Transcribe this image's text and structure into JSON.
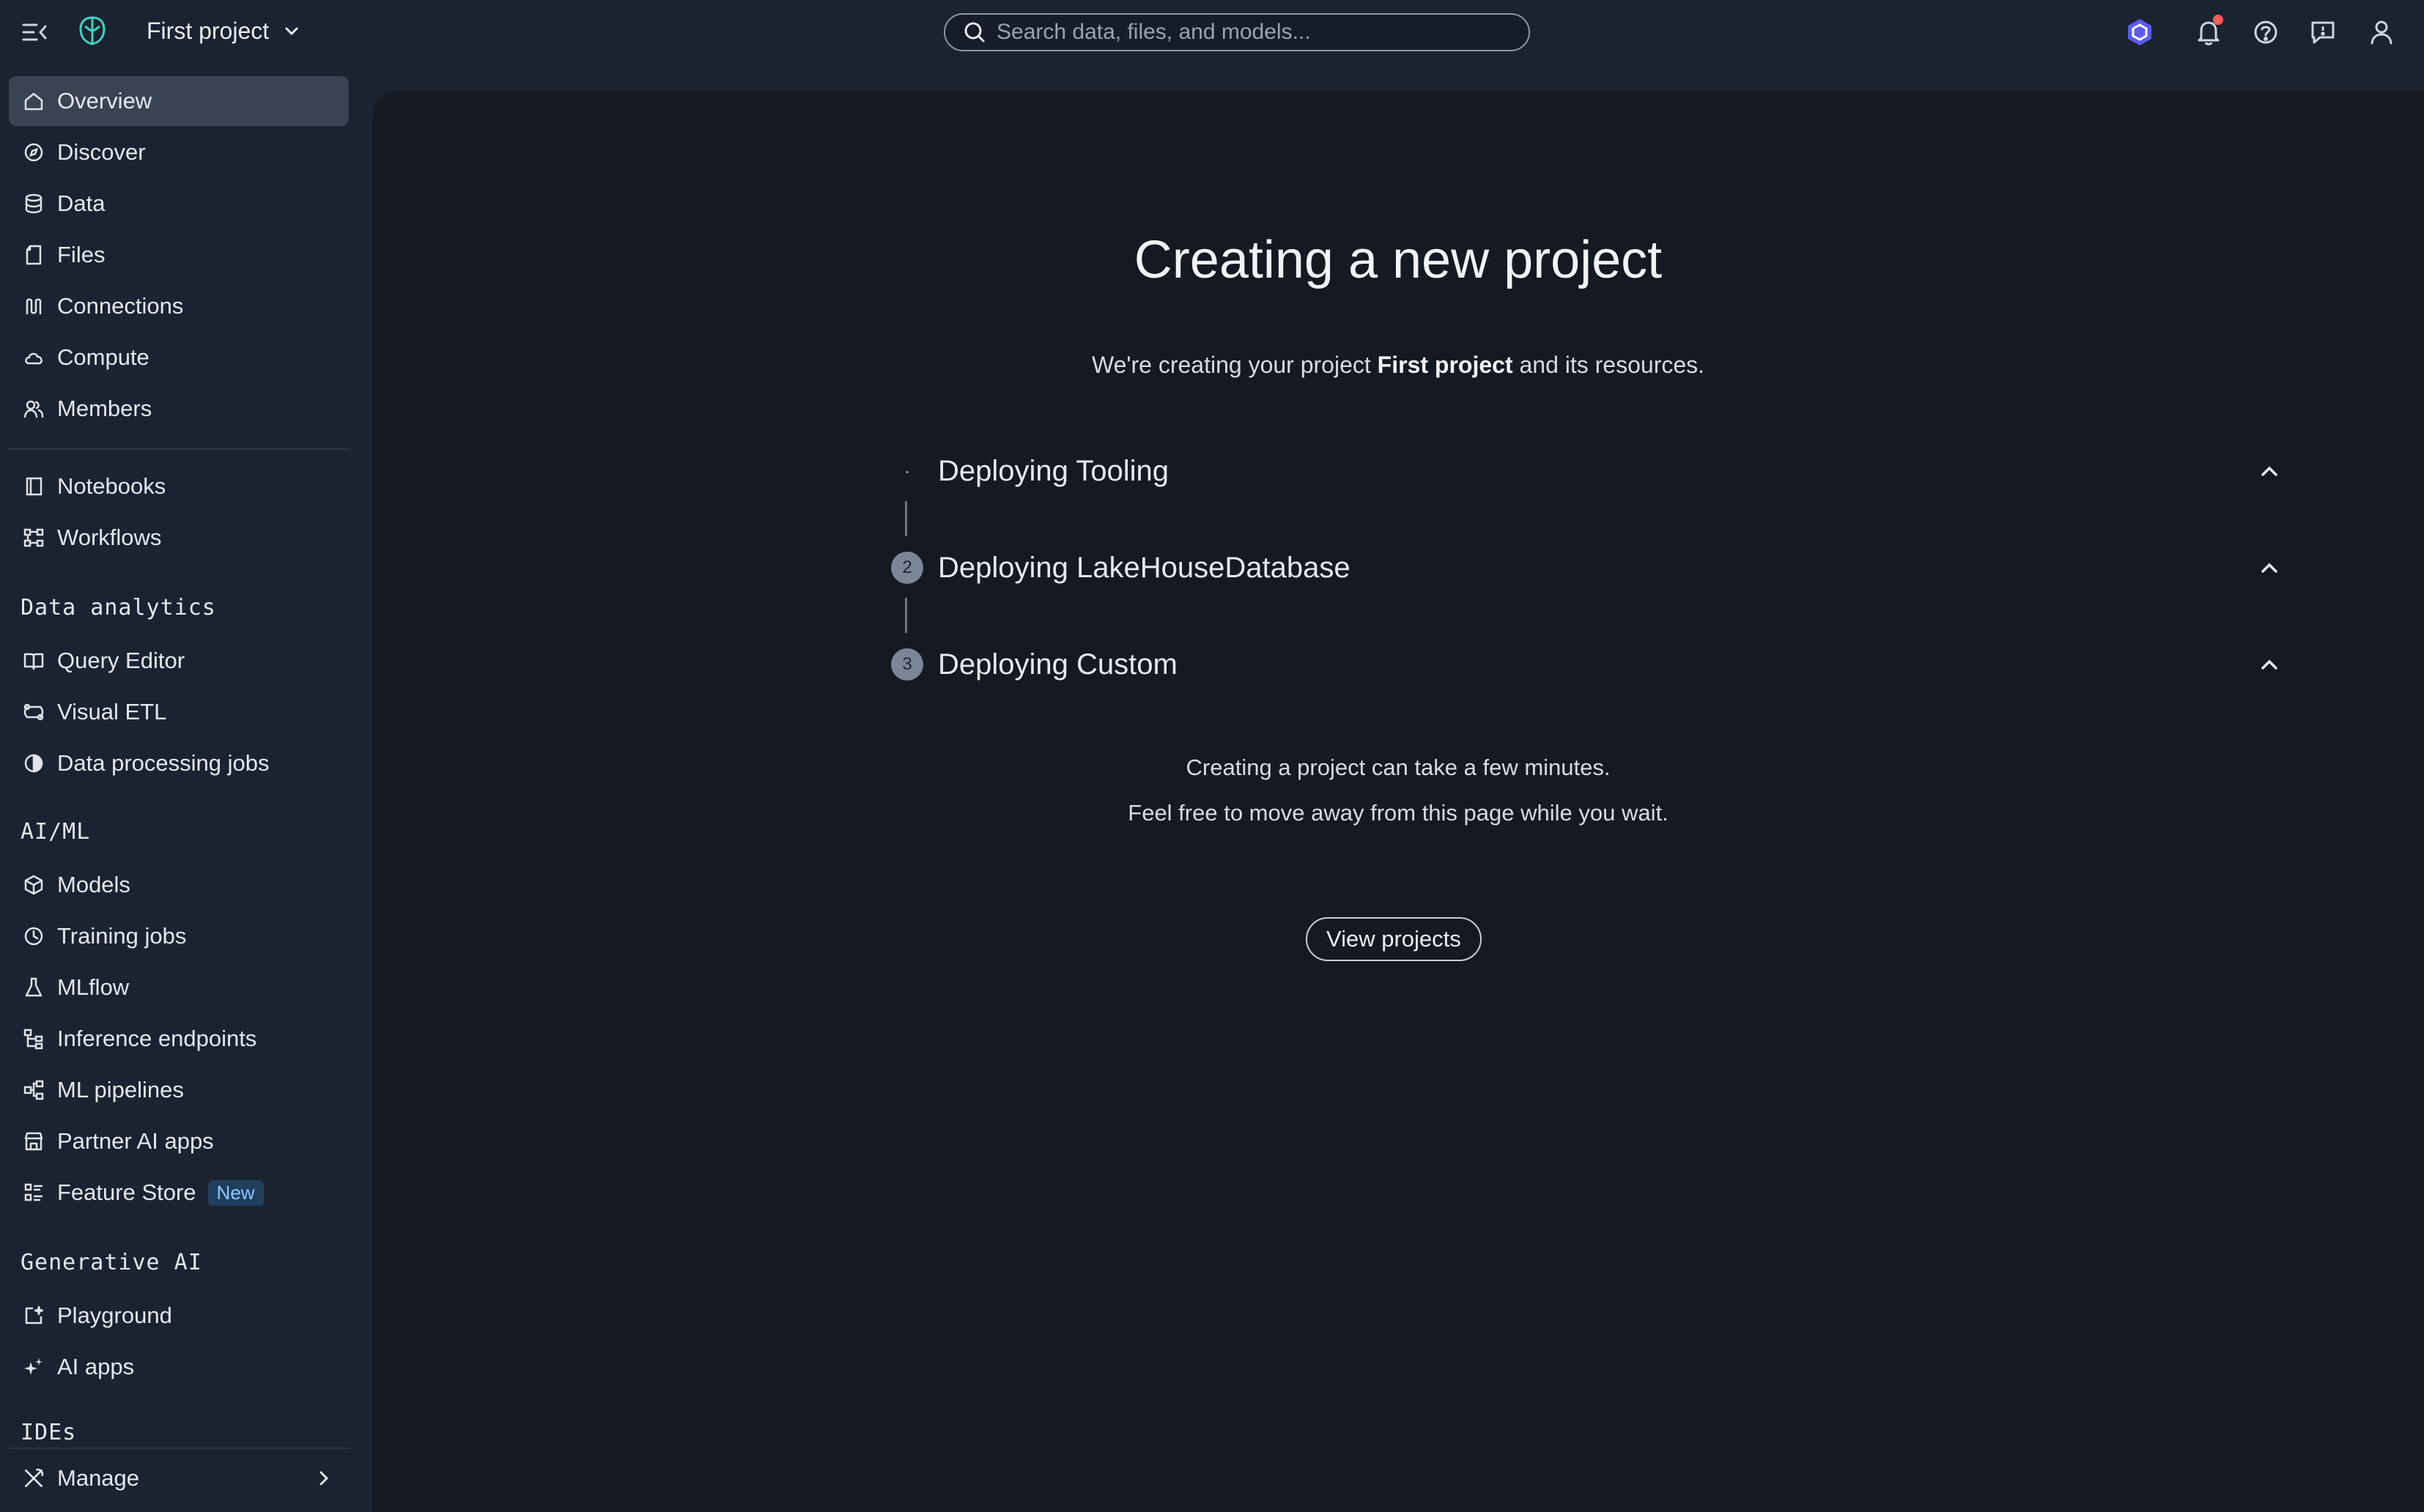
{
  "header": {
    "project_name": "First project",
    "search_placeholder": "Search data, files, and models..."
  },
  "sidebar": {
    "items": [
      {
        "label": "Overview",
        "icon": "home-icon",
        "active": true
      },
      {
        "label": "Discover",
        "icon": "compass-icon"
      },
      {
        "label": "Data",
        "icon": "database-icon"
      },
      {
        "label": "Files",
        "icon": "file-icon"
      },
      {
        "label": "Connections",
        "icon": "connections-icon"
      },
      {
        "label": "Compute",
        "icon": "cloud-icon"
      },
      {
        "label": "Members",
        "icon": "members-icon"
      },
      {
        "label": "Notebooks",
        "icon": "notebook-icon"
      },
      {
        "label": "Workflows",
        "icon": "workflow-icon"
      }
    ],
    "data_analytics": {
      "title": "Data analytics",
      "items": [
        {
          "label": "Query Editor",
          "icon": "book-icon"
        },
        {
          "label": "Visual ETL",
          "icon": "etl-icon"
        },
        {
          "label": "Data processing jobs",
          "icon": "processing-icon"
        }
      ]
    },
    "aiml": {
      "title": "AI/ML",
      "items": [
        {
          "label": "Models",
          "icon": "cube-icon"
        },
        {
          "label": "Training jobs",
          "icon": "clock-icon"
        },
        {
          "label": "MLflow",
          "icon": "flask-icon"
        },
        {
          "label": "Inference endpoints",
          "icon": "endpoints-icon"
        },
        {
          "label": "ML pipelines",
          "icon": "pipeline-icon"
        },
        {
          "label": "Partner AI apps",
          "icon": "store-icon"
        },
        {
          "label": "Feature Store",
          "icon": "feature-list-icon",
          "badge": "New"
        }
      ]
    },
    "genai": {
      "title": "Generative AI",
      "items": [
        {
          "label": "Playground",
          "icon": "playground-icon"
        },
        {
          "label": "AI apps",
          "icon": "sparkle-icon"
        }
      ]
    },
    "ides_title": "IDEs",
    "manage_label": "Manage"
  },
  "main": {
    "title": "Creating a new project",
    "subtitle_prefix": "We're creating your project ",
    "subtitle_project": "First project",
    "subtitle_suffix": " and its resources.",
    "steps": [
      {
        "marker": "·",
        "label": "Deploying Tooling"
      },
      {
        "marker": "2",
        "label": "Deploying LakeHouseDatabase"
      },
      {
        "marker": "3",
        "label": "Deploying Custom"
      }
    ],
    "note_line1": "Creating a project can take a few minutes.",
    "note_line2": "Feel free to move away from this page while you wait.",
    "button_label": "View projects"
  },
  "colors": {
    "background": "#1b2330",
    "panel": "#141922",
    "active_item": "#3a4352",
    "badge_bg": "#1f3f5c",
    "badge_text": "#8cc8ff",
    "notification_dot": "#ff5b5b",
    "logo_accent": "#3fd3c4"
  }
}
